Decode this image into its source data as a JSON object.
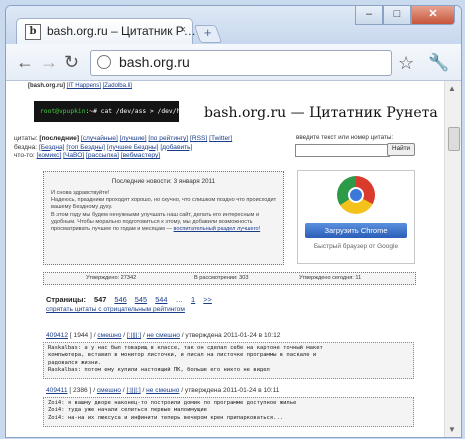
{
  "browser": {
    "tab_title": "bash.org.ru – Цитатник Р…",
    "tab_close": "×",
    "favicon_letter": "b",
    "new_tab": "+",
    "url": "bash.org.ru",
    "window_buttons": {
      "minimize": "–",
      "maximize": "□",
      "close": "✕"
    },
    "nav_icons": {
      "back": "←",
      "forward": "→",
      "reload": "↻",
      "star": "☆",
      "wrench": "🔧"
    }
  },
  "page": {
    "top_strip": {
      "current": "[bash.org.ru]",
      "links": [
        "[IT Happens]",
        "[Zadolba.li]"
      ]
    },
    "terminal": {
      "prompt": "root@vpupkin",
      "command": ":~# cat /dev/ass > /dev/head"
    },
    "site_title": "bash.org.ru — Цитатник Рунета",
    "nav": {
      "quotes": {
        "label": "цитаты:",
        "current": "[последние]",
        "links": [
          "[случайные]",
          "[лучшие]",
          "[по рейтингу]",
          "[RSS]",
          "[Twitter]"
        ]
      },
      "abyss": {
        "label": "бездна:",
        "links": [
          "[Бездна]",
          "[топ Бездны]",
          "[лучшее Бездны]",
          "[добавить]"
        ]
      },
      "other": {
        "label": "что-то:",
        "links": [
          "[комикс]",
          "[ЧаВО]",
          "[рассылка]",
          "[вебмастеру]"
        ]
      }
    },
    "search": {
      "label": "введите текст или номер цитаты:",
      "value": "",
      "button": "Найти"
    },
    "news": {
      "heading": "Последние новости: 3 января 2011",
      "lines": [
        "И снова здравствуйте!",
        "Надеюсь, праздники проходят хорошо, но скучно, что слишком поздно что происходит вашему Бездному духу.",
        "В этом году мы будем ненужными улучшать наш сайт, делать его интересным и удобным. Чтобы морально подготовиться к этому, мы добавили возможность просматривать лучшее по годам и месяцам — ",
        "воспитательный раздел лучшего!"
      ]
    },
    "ad": {
      "button": "Загрузить Chrome",
      "caption": "Быстрый браузер от Google"
    },
    "stats": {
      "approved": "Утверждено: 27342",
      "pending": "В рассмотрении: 303",
      "today": "Утверждено сегодня: 11"
    },
    "pager": {
      "label": "Страницы:",
      "current": "547",
      "pages": [
        "546",
        "545",
        "544"
      ],
      "ellipsis": "…",
      "first": "1",
      "next": ">>"
    },
    "hide_negative": "спрятать цитаты с отрицательным рейтингом",
    "quotes": [
      {
        "id": "409412",
        "rating": "[ 1944 ]",
        "actions": [
          "смешно",
          "[:||||:]",
          "не смешно"
        ],
        "date": "утверждена 2011-01-24 в 10:12",
        "lines": [
          "Raskalbas: а у нас был товарищ в классе, так он сделал себе на картоне точный макет",
          "компьютера, вставил в монитор листочки, и писал на листочке программы в паскале и",
          "радовался жизни.",
          "Raskalbas: потом ему купили настоящий ПК, больше его никто не видел"
        ]
      },
      {
        "id": "409411",
        "rating": "[ 2386 ]",
        "actions": [
          "смешно",
          "[:||||:]",
          "не смешно"
        ],
        "date": "утверждена 2011-01-24 в 10:11",
        "lines": [
          "Zoi4: я вашму дворе наконец-то построили домик по программе доступное жилье",
          "Zoi4: туда уже начали селиться первые малоимущие",
          "Zoi4: на-на их люксуса и инфинити теперь вечером крен припарковаться..."
        ]
      }
    ]
  }
}
